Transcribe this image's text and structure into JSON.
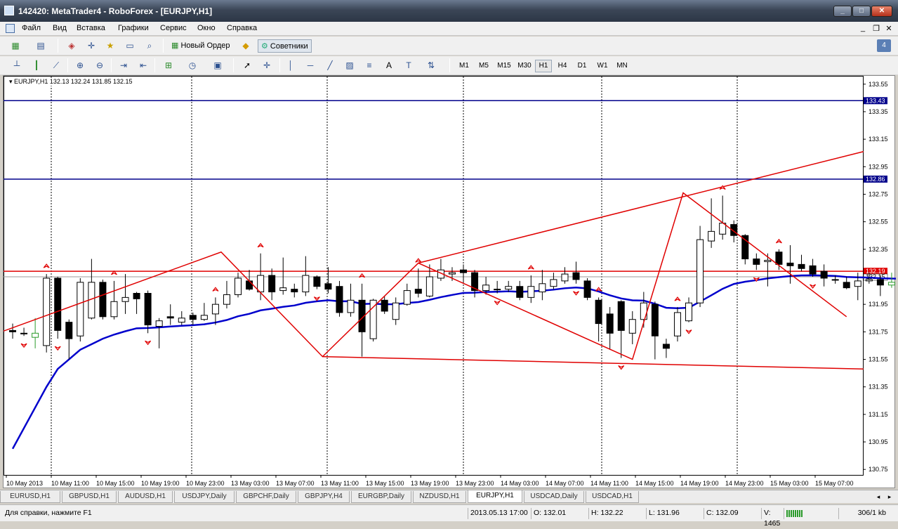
{
  "window": {
    "title": "142420: MetaTrader4 - RoboForex - [EURJPY,H1]"
  },
  "menu": {
    "items": [
      "Файл",
      "Вид",
      "Вставка",
      "Графики",
      "Сервис",
      "Окно",
      "Справка"
    ]
  },
  "toolbar": {
    "new_order_label": "Новый Ордер",
    "experts_label": "Советники"
  },
  "timeframes": [
    "M1",
    "M5",
    "M15",
    "M30",
    "H1",
    "H4",
    "D1",
    "W1",
    "MN"
  ],
  "active_timeframe": "H1",
  "chart": {
    "header": "EURJPY,H1  132.13 132.24 131.85 132.15",
    "hline_labels": [
      "133.43",
      "132.86",
      "132.19"
    ],
    "current_price": "132.15",
    "colors": {
      "bull": "#ffffff",
      "bear": "#000000",
      "ma": "#0000cc",
      "zigzag": "#e00000",
      "hline_blue": "#00008b",
      "hline_red": "#e00000",
      "grid": "#000000"
    }
  },
  "chart_data": {
    "type": "candlestick",
    "symbol": "EURJPY",
    "timeframe": "H1",
    "y_ticks": [
      133.55,
      133.35,
      133.15,
      132.95,
      132.75,
      132.55,
      132.35,
      132.15,
      131.95,
      131.75,
      131.55,
      131.35,
      131.15,
      130.95,
      130.75
    ],
    "ylim": [
      130.7,
      133.6
    ],
    "x_labels": [
      "10 May 2013",
      "10 May 11:00",
      "10 May 15:00",
      "10 May 19:00",
      "10 May 23:00",
      "13 May 03:00",
      "13 May 07:00",
      "13 May 11:00",
      "13 May 15:00",
      "13 May 19:00",
      "13 May 23:00",
      "14 May 03:00",
      "14 May 07:00",
      "14 May 11:00",
      "14 May 15:00",
      "14 May 19:00",
      "14 May 23:00",
      "15 May 03:00",
      "15 May 07:00"
    ],
    "horizontal_lines": [
      133.43,
      132.86,
      132.19
    ],
    "candles": [
      [
        131.76,
        131.75,
        131.81,
        131.7
      ],
      [
        131.74,
        131.74,
        131.78,
        131.72
      ],
      [
        131.71,
        131.74,
        131.85,
        131.63
      ],
      [
        131.65,
        132.14,
        132.17,
        131.6
      ],
      [
        132.14,
        131.76,
        132.15,
        131.7
      ],
      [
        131.82,
        131.7,
        131.84,
        131.55
      ],
      [
        131.72,
        132.11,
        132.14,
        131.68
      ],
      [
        131.85,
        132.11,
        132.28,
        131.84
      ],
      [
        132.11,
        131.86,
        132.13,
        131.84
      ],
      [
        131.86,
        131.97,
        132.12,
        131.84
      ],
      [
        131.97,
        132.0,
        132.17,
        131.88
      ],
      [
        132.03,
        131.99,
        132.04,
        131.88
      ],
      [
        132.03,
        131.8,
        132.05,
        131.74
      ],
      [
        131.79,
        131.83,
        131.85,
        131.63
      ],
      [
        131.86,
        131.85,
        131.95,
        131.8
      ],
      [
        131.82,
        131.85,
        131.9,
        131.8
      ],
      [
        131.87,
        131.84,
        131.89,
        131.8
      ],
      [
        131.84,
        131.87,
        131.96,
        131.83
      ],
      [
        131.88,
        131.95,
        132.0,
        131.8
      ],
      [
        131.95,
        132.02,
        132.12,
        131.92
      ],
      [
        132.02,
        132.14,
        132.18,
        132.0
      ],
      [
        132.12,
        132.06,
        132.2,
        132.05
      ],
      [
        132.04,
        132.16,
        132.32,
        131.98
      ],
      [
        132.16,
        132.04,
        132.21,
        131.98
      ],
      [
        132.05,
        132.07,
        132.29,
        132.02
      ],
      [
        132.06,
        132.04,
        132.1,
        132.0
      ],
      [
        132.04,
        132.16,
        132.3,
        132.01
      ],
      [
        132.15,
        132.08,
        132.16,
        132.06
      ],
      [
        132.1,
        132.06,
        132.22,
        132.03
      ],
      [
        132.08,
        131.89,
        132.12,
        131.86
      ],
      [
        131.89,
        131.98,
        132.1,
        131.86
      ],
      [
        131.98,
        131.75,
        132.1,
        131.57
      ],
      [
        131.7,
        131.98,
        131.99,
        131.68
      ],
      [
        131.98,
        131.9,
        132.01,
        131.88
      ],
      [
        131.84,
        131.96,
        132.0,
        131.8
      ],
      [
        131.95,
        132.05,
        132.1,
        131.94
      ],
      [
        132.06,
        132.03,
        132.21,
        132.0
      ],
      [
        132.01,
        132.15,
        132.24,
        132.0
      ],
      [
        132.14,
        132.2,
        132.28,
        132.12
      ],
      [
        132.17,
        132.18,
        132.22,
        132.12
      ],
      [
        132.2,
        132.18,
        132.24,
        132.1
      ],
      [
        132.18,
        132.05,
        132.2,
        132.0
      ],
      [
        132.05,
        132.09,
        132.15,
        132.02
      ],
      [
        132.06,
        132.06,
        132.12,
        132.03
      ],
      [
        132.06,
        132.08,
        132.12,
        132.04
      ],
      [
        132.08,
        132.0,
        132.12,
        131.98
      ],
      [
        132.0,
        132.08,
        132.16,
        131.96
      ],
      [
        132.04,
        132.1,
        132.2,
        131.98
      ],
      [
        132.08,
        132.13,
        132.18,
        132.06
      ],
      [
        132.12,
        132.17,
        132.22,
        132.1
      ],
      [
        132.18,
        132.13,
        132.26,
        132.1
      ],
      [
        132.12,
        132.0,
        132.14,
        131.98
      ],
      [
        131.98,
        131.81,
        132.0,
        131.68
      ],
      [
        131.88,
        131.74,
        131.93,
        131.62
      ],
      [
        131.97,
        131.76,
        131.98,
        131.56
      ],
      [
        131.74,
        131.84,
        131.9,
        131.66
      ],
      [
        131.84,
        131.96,
        132.04,
        131.78
      ],
      [
        131.95,
        131.72,
        131.97,
        131.55
      ],
      [
        131.66,
        131.63,
        131.7,
        131.56
      ],
      [
        131.72,
        131.89,
        131.93,
        131.68
      ],
      [
        131.83,
        131.96,
        132.0,
        131.82
      ],
      [
        131.96,
        132.42,
        132.52,
        131.93
      ],
      [
        132.41,
        132.48,
        132.72,
        132.36
      ],
      [
        132.46,
        132.54,
        132.74,
        132.42
      ],
      [
        132.53,
        132.45,
        132.56,
        132.4
      ],
      [
        132.45,
        132.28,
        132.46,
        132.24
      ],
      [
        132.28,
        132.24,
        132.32,
        132.2
      ],
      [
        132.26,
        132.27,
        132.32,
        132.08
      ],
      [
        132.33,
        132.24,
        132.35,
        132.2
      ],
      [
        132.25,
        132.23,
        132.38,
        132.1
      ],
      [
        132.24,
        132.21,
        132.31,
        132.19
      ],
      [
        132.23,
        132.17,
        132.28,
        132.15
      ],
      [
        132.19,
        132.14,
        132.24,
        132.08
      ],
      [
        132.13,
        132.13,
        132.16,
        132.1
      ],
      [
        132.11,
        132.07,
        132.15,
        132.06
      ],
      [
        132.08,
        132.12,
        132.18,
        131.98
      ],
      [
        132.12,
        132.13,
        132.18,
        132.1
      ],
      [
        132.13,
        132.09,
        132.16,
        132.01
      ],
      [
        132.09,
        132.11,
        132.18,
        132.07
      ],
      [
        132.11,
        132.12,
        132.26,
        132.06
      ],
      [
        132.12,
        132.15,
        132.24,
        131.85
      ]
    ],
    "bullish_marker_candles": [
      2,
      78,
      79,
      80
    ],
    "ma": {
      "name": "",
      "color": "#0000cc"
    },
    "zigzag_points": [
      [
        131.75,
        -1
      ],
      [
        132.33,
        18.5
      ],
      [
        131.57,
        27.5
      ],
      [
        132.25,
        36
      ],
      [
        131.55,
        55
      ],
      [
        132.76,
        59.5
      ],
      [
        131.86,
        74
      ]
    ],
    "channel_lines": [
      {
        "from": [
          36,
          132.25
        ],
        "to": [
          75.5,
          133.06
        ]
      },
      {
        "from": [
          27.5,
          131.57
        ],
        "to": [
          75.5,
          131.48
        ]
      }
    ],
    "fractals_up": [
      3,
      9,
      18,
      22,
      31,
      36,
      46,
      52,
      59,
      63,
      68
    ],
    "fractals_down": [
      1,
      4,
      12,
      27,
      43,
      50,
      54,
      60,
      66,
      71
    ],
    "ohlc_header": {
      "open": 132.13,
      "high": 132.24,
      "low": 131.85,
      "close": 132.15
    }
  },
  "tabs": [
    "EURUSD,H1",
    "GBPUSD,H1",
    "AUDUSD,H1",
    "USDJPY,Daily",
    "GBPCHF,Daily",
    "GBPJPY,H4",
    "EURGBP,Daily",
    "NZDUSD,H1",
    "EURJPY,H1",
    "USDCAD,Daily",
    "USDCAD,H1"
  ],
  "active_tab": "EURJPY,H1",
  "status": {
    "help": "Для справки, нажмите F1",
    "time": "2013.05.13 17:00",
    "open": "O: 132.01",
    "high": "H: 132.22",
    "low": "L: 131.96",
    "close": "C: 132.09",
    "volume": "V: 1465",
    "traffic": "306/1 kb"
  }
}
